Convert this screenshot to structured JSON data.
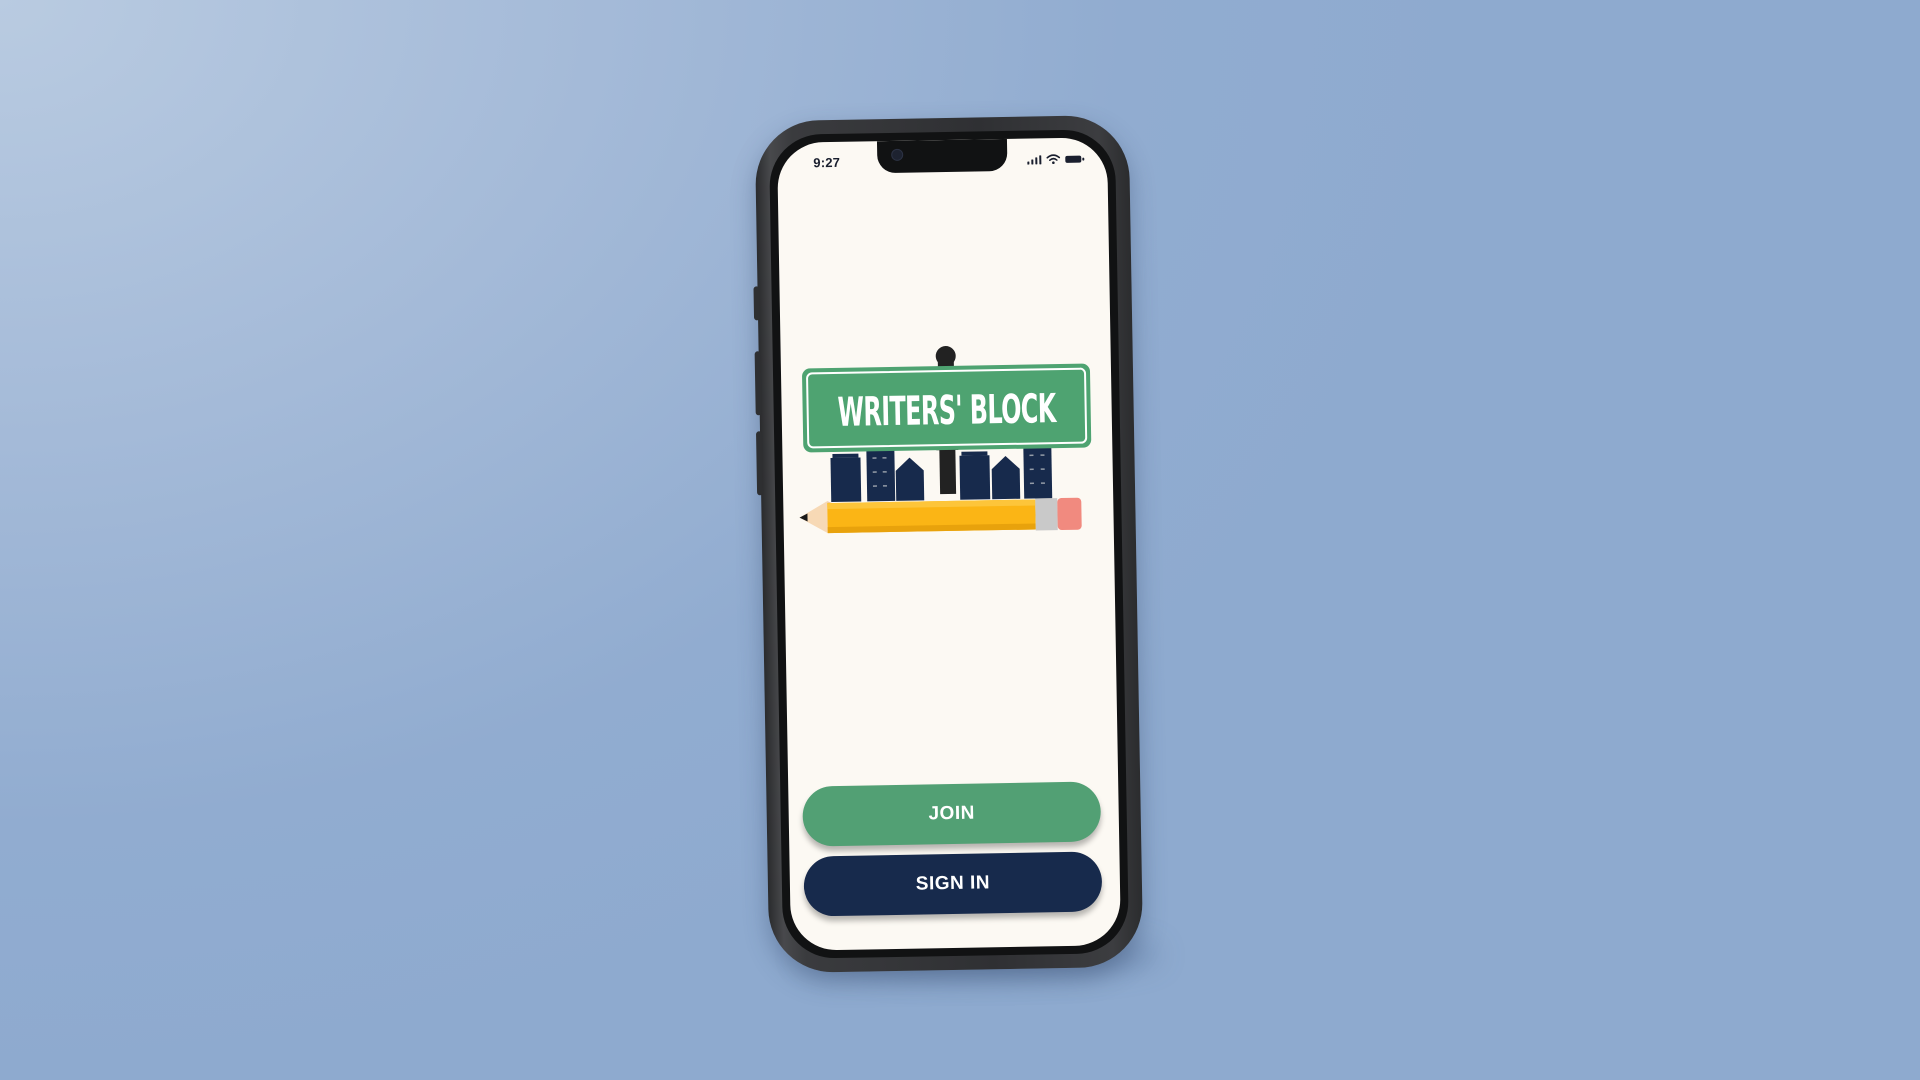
{
  "status_bar": {
    "time": "9:27",
    "icons": [
      "signal-icon",
      "wifi-icon",
      "battery-icon"
    ]
  },
  "logo": {
    "sign_text": "WRITERS' BLOCK",
    "sign_color": "#4ea371",
    "skyline_color": "#172a4c",
    "pencil_color": "#fbb515",
    "eraser_color": "#f18a7f"
  },
  "buttons": {
    "join_label": "JOIN",
    "signin_label": "SIGN IN"
  },
  "colors": {
    "screen_background": "#fcf9f3",
    "join_button": "#52a074",
    "signin_button": "#172a4c",
    "page_background": "#91acd0"
  }
}
